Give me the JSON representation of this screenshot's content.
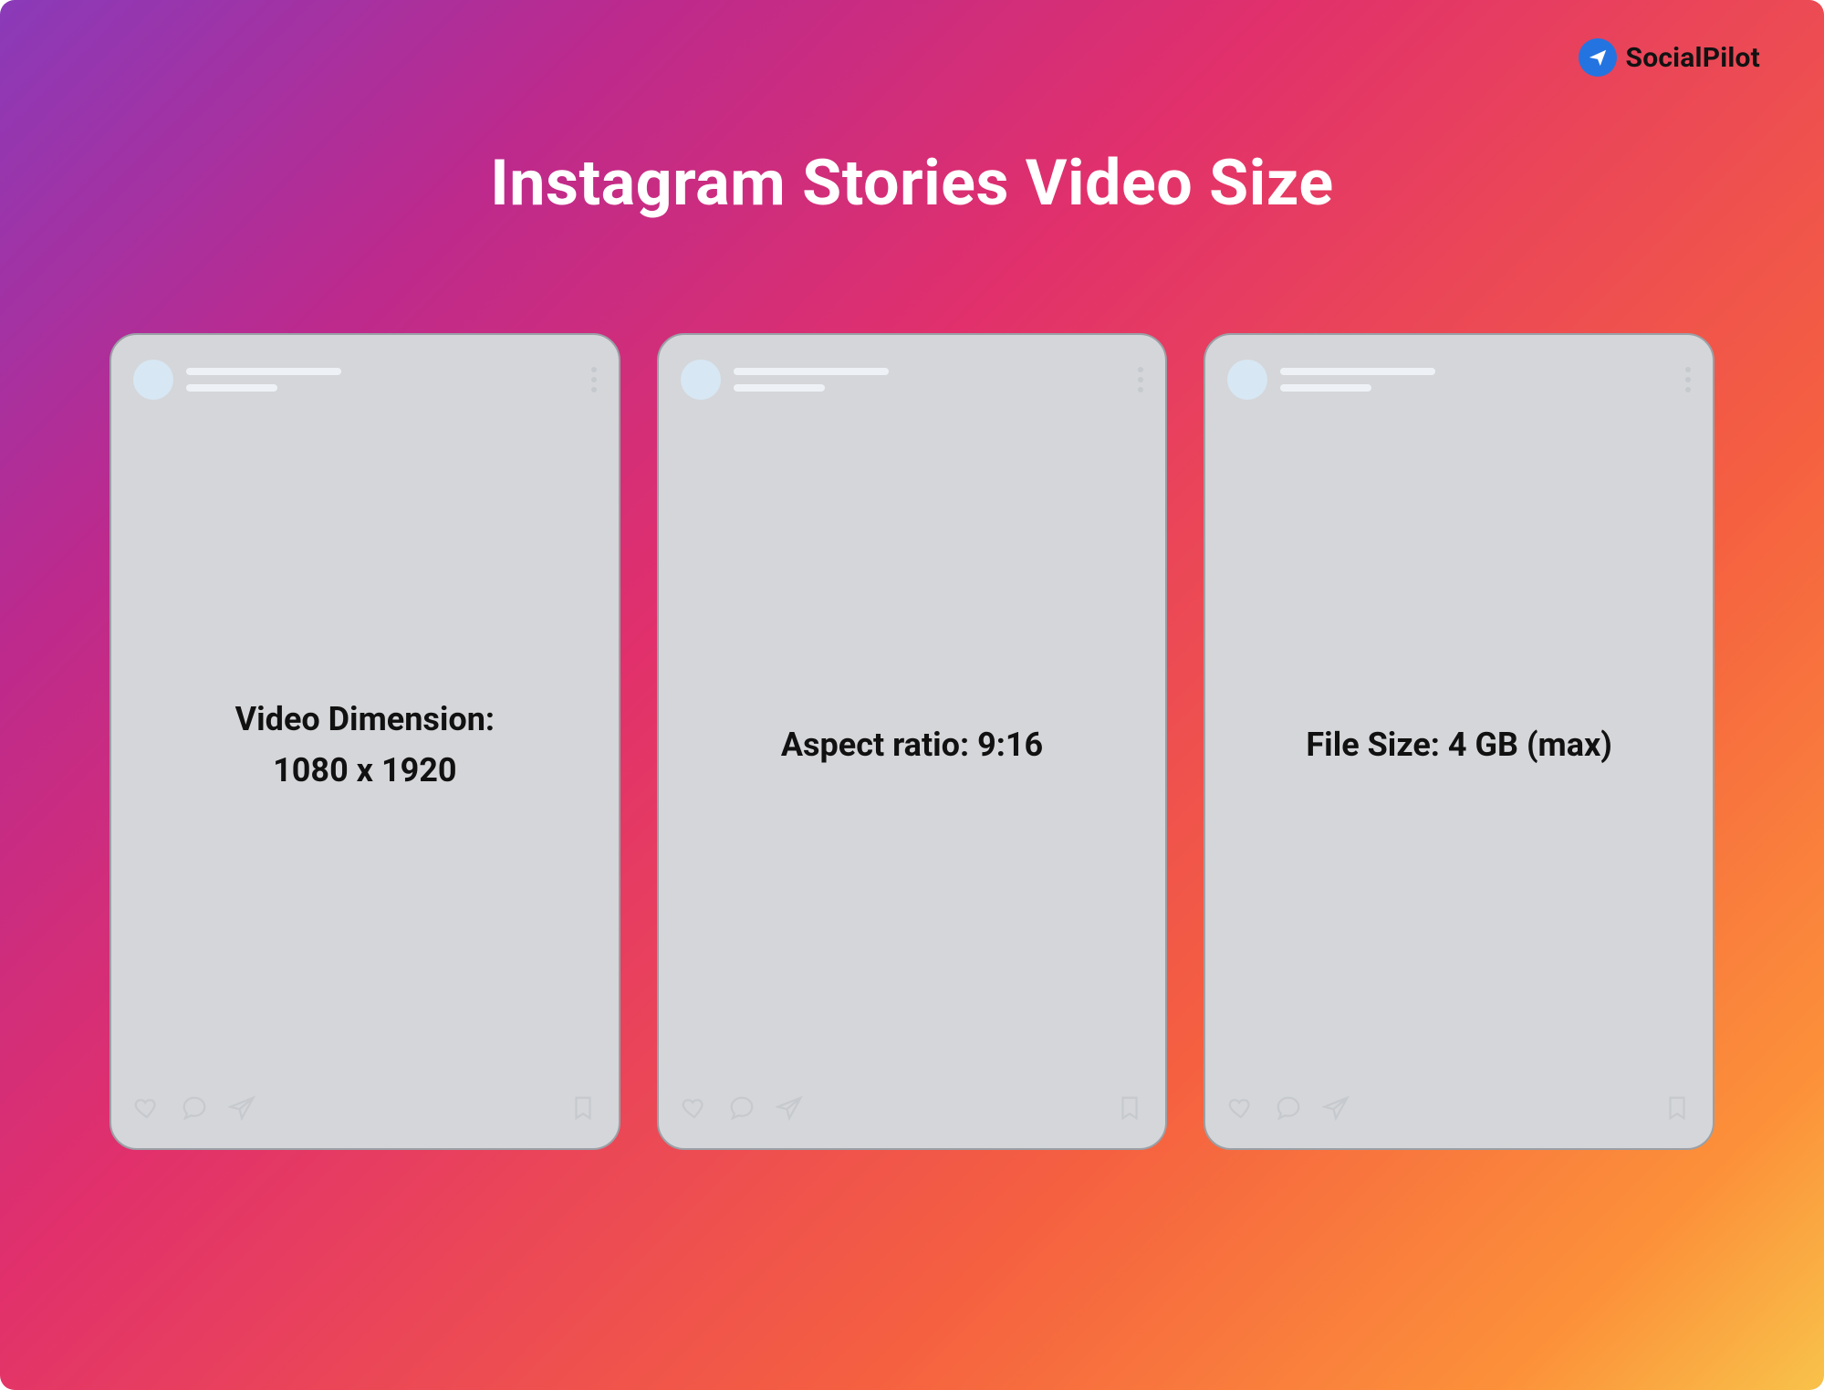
{
  "brand": {
    "name": "SocialPilot"
  },
  "title": "Instagram Stories Video Size",
  "cards": [
    {
      "line1": "Video Dimension:",
      "line2": "1080 x 1920"
    },
    {
      "line1": "Aspect ratio: 9:16",
      "line2": ""
    },
    {
      "line1": "File Size: 4 GB (max)",
      "line2": ""
    }
  ]
}
